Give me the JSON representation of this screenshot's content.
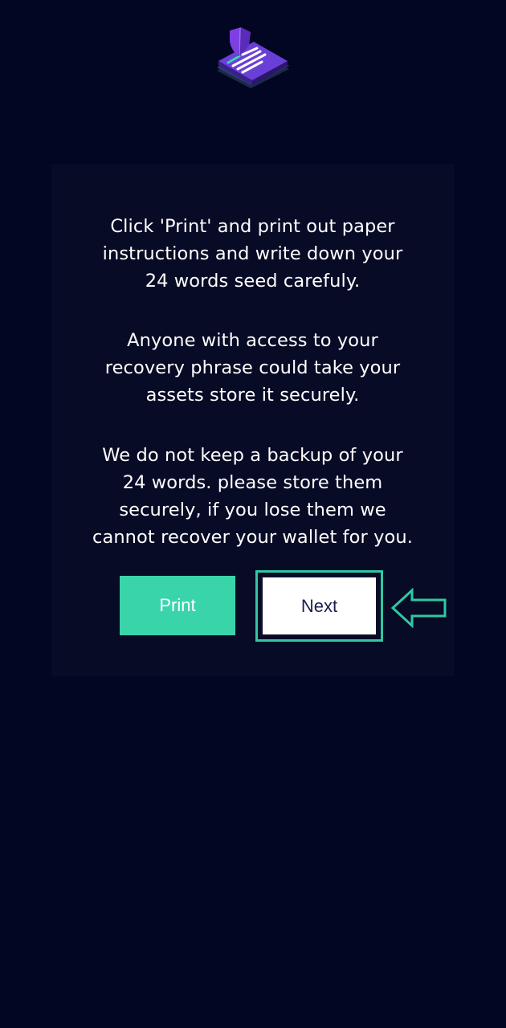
{
  "logo_icon": "shielded-document-logo-icon",
  "instructions": {
    "paragraph_1": "Click 'Print' and print out paper\ninstructions and write down your\n24 words seed carefuly.",
    "paragraph_2": "Anyone with access to your\nrecovery phrase could take your\nassets store it securely.",
    "paragraph_3": "We do not keep a backup of your\n24 words. please store them\nsecurely, if you lose them we\ncannot recover your wallet for you."
  },
  "buttons": {
    "print_label": "Print",
    "next_label": "Next"
  },
  "annotation_icon": "left-arrow-outline-icon",
  "colors": {
    "background": "#030622",
    "card": "#080b26",
    "accent": "#3ad4ab",
    "highlight": "#2fc8a3"
  }
}
